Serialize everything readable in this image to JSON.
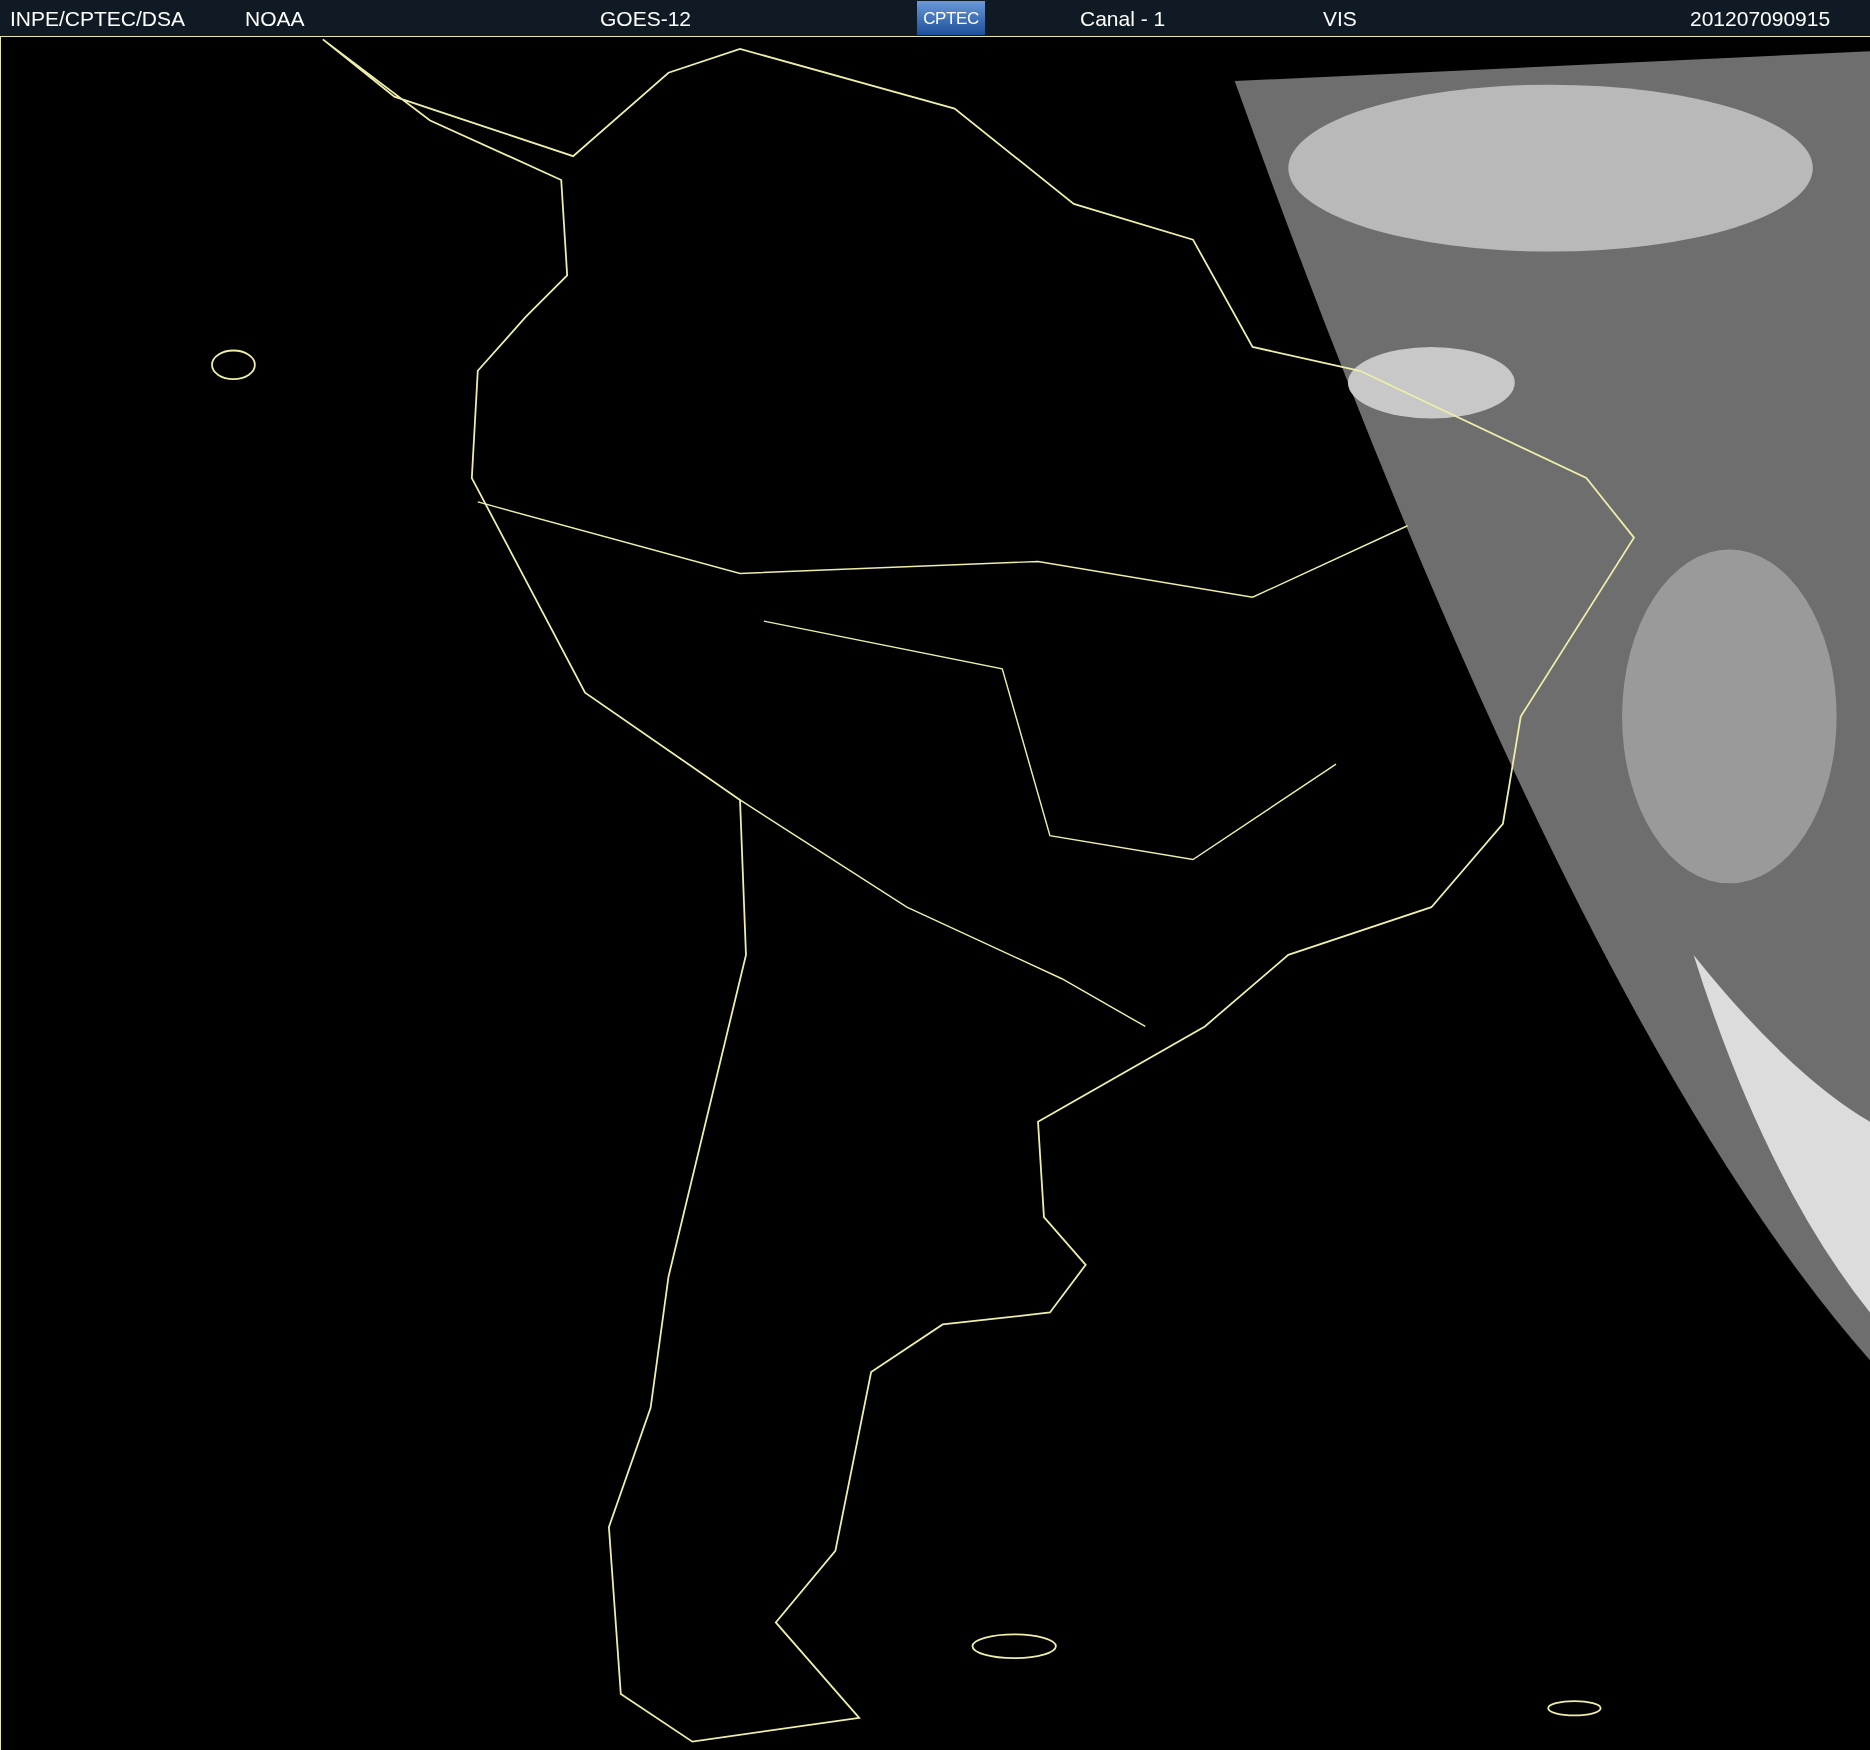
{
  "header": {
    "source": "INPE/CPTEC/DSA",
    "agency": "NOAA",
    "satellite": "GOES-12",
    "logo": "CPTEC",
    "channel": "Canal - 1",
    "band": "VIS",
    "timestamp": "201207090915"
  }
}
